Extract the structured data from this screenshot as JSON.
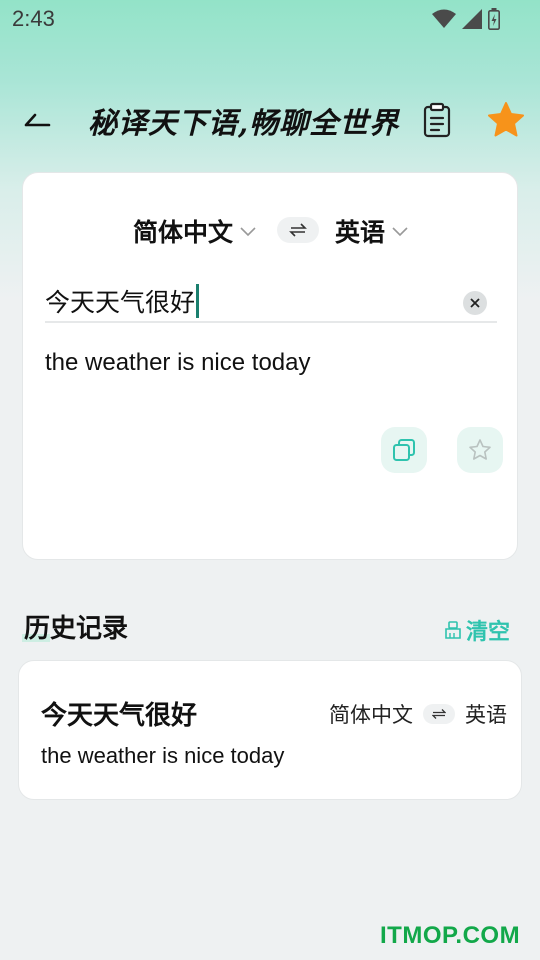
{
  "status_bar": {
    "time": "2:43"
  },
  "header": {
    "title": "秘译天下语,畅聊全世界"
  },
  "translator": {
    "source_lang": "简体中文",
    "target_lang": "英语",
    "input_text": "今天天气很好",
    "result_text": "the weather is nice today"
  },
  "history": {
    "title": "历史记录",
    "clear_label": "清空",
    "items": [
      {
        "source": "今天天气很好",
        "target": "the weather is nice today",
        "source_lang": "简体中文",
        "target_lang": "英语"
      }
    ]
  },
  "watermark": "ITMOP.COM",
  "colors": {
    "accent": "#2fc3ae",
    "star": "#f7931a",
    "watermark": "#12a84a"
  },
  "icons": [
    "wifi-icon",
    "signal-icon",
    "battery-icon",
    "back-arrow-icon",
    "clipboard-icon",
    "star-filled-icon",
    "chevron-down-icon",
    "swap-icon",
    "clear-icon",
    "copy-icon",
    "star-outline-icon",
    "broom-icon"
  ]
}
